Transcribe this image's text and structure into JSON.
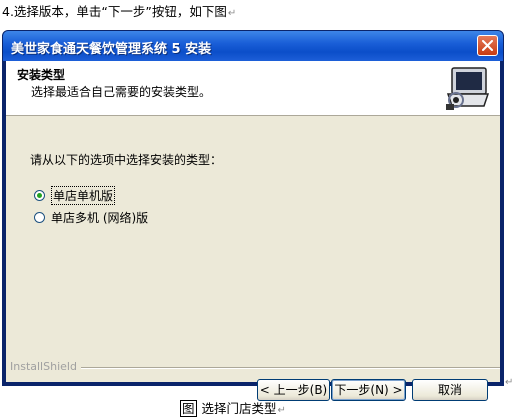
{
  "doc": {
    "step_text": "4.选择版本，单击“下一步”按钮，如下图",
    "para_mark": "↵",
    "caption_prefix": "图",
    "caption_text": "选择门店类型"
  },
  "window": {
    "title": "美世家食通天餐饮管理系统 5 安装",
    "header": {
      "title": "安装类型",
      "subtitle": "选择最适合自己需要的安装类型。"
    },
    "prompt": "请从以下的选项中选择安装的类型：",
    "options": [
      {
        "label": "单店单机版",
        "selected": true
      },
      {
        "label": "单店多机 (网络)版",
        "selected": false
      }
    ],
    "brand_label": "InstallShield",
    "buttons": {
      "back": "< 上一步(B)",
      "next": "下一步(N) >",
      "cancel": "取消"
    }
  },
  "colors": {
    "titlebar": "#0b4ec9",
    "dialog_bg": "#ece9d8",
    "close_button": "#c83b12",
    "radio_dot": "#21a121"
  },
  "icons": [
    "close-icon",
    "installer-computer-icon",
    "radio-checked",
    "radio-unchecked"
  ]
}
